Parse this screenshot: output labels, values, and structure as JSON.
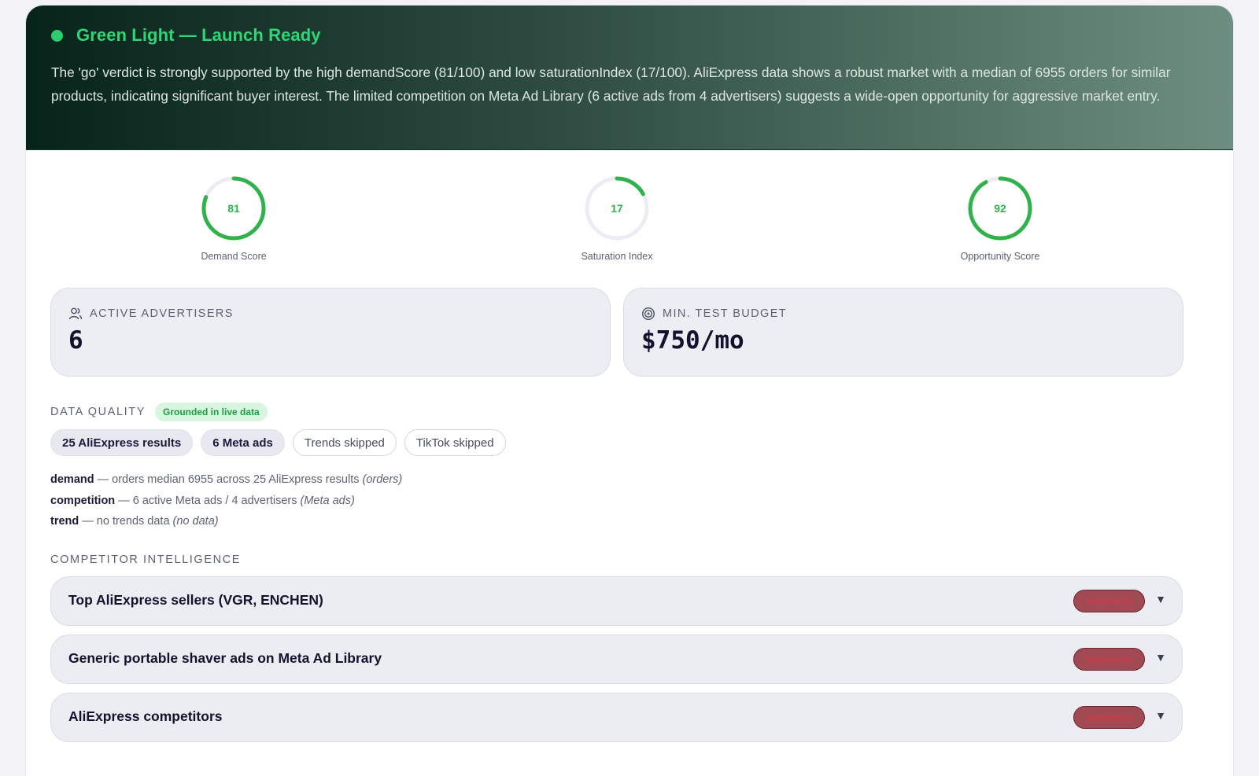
{
  "verdict": {
    "title": "Green Light — Launch Ready",
    "summary": "The 'go' verdict is strongly supported by the high demandScore (81/100) and low saturationIndex (17/100). AliExpress data shows a robust market with a median of 6955 orders for similar products, indicating significant buyer interest. The limited competition on Meta Ad Library (6 active ads from 4 advertisers) suggests a wide-open opportunity for aggressive market entry.",
    "status_color": "#2ecc71"
  },
  "gauges": [
    {
      "value": 81,
      "label": "Demand Score"
    },
    {
      "value": 17,
      "label": "Saturation Index"
    },
    {
      "value": 92,
      "label": "Opportunity Score"
    }
  ],
  "stats": {
    "advertisers": {
      "label": "ACTIVE ADVERTISERS",
      "value": "6",
      "icon": "users-icon"
    },
    "budget": {
      "label": "MIN. TEST BUDGET",
      "value": "$750/mo",
      "icon": "target-icon"
    }
  },
  "data_quality": {
    "label": "DATA QUALITY",
    "badge": "Grounded in live data",
    "chips": [
      {
        "text": "25 AliExpress results",
        "style": "filled"
      },
      {
        "text": "6 Meta ads",
        "style": "filled"
      },
      {
        "text": "Trends skipped",
        "style": "outline"
      },
      {
        "text": "TikTok skipped",
        "style": "outline"
      }
    ],
    "signals": [
      {
        "key": "demand",
        "text": " — orders median 6955 across 25 AliExpress results ",
        "source": "(orders)"
      },
      {
        "key": "competition",
        "text": " — 6 active Meta ads / 4 advertisers ",
        "source": "(Meta ads)"
      },
      {
        "key": "trend",
        "text": " — no trends data ",
        "source": "(no data)"
      }
    ]
  },
  "competitors": {
    "label": "COMPETITOR INTELLIGENCE",
    "items": [
      {
        "title": "Top AliExpress sellers (VGR, ENCHEN)",
        "tag": "weakness"
      },
      {
        "title": "Generic portable shaver ads on Meta Ad Library",
        "tag": "weakness"
      },
      {
        "title": "AliExpress competitors",
        "tag": "weakness"
      }
    ]
  },
  "colors": {
    "accent_green": "#2fb24a",
    "weakness_tag": "#a14a53"
  }
}
